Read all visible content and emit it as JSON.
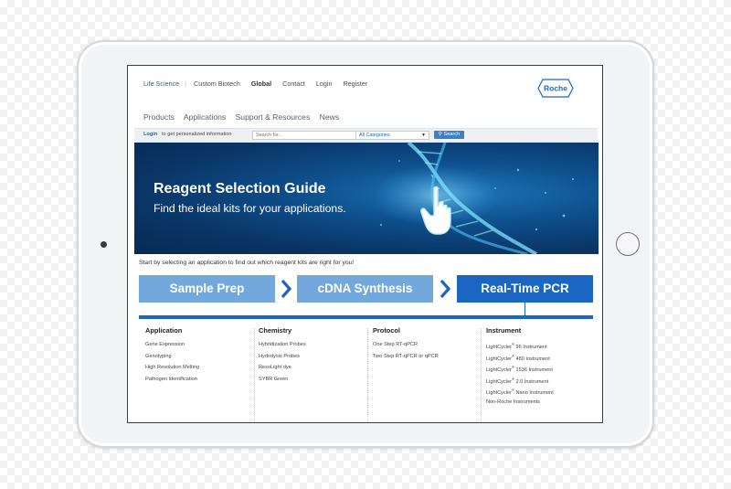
{
  "top_nav": {
    "items": [
      "Life Science",
      "Custom Biotech",
      "Global",
      "Contact",
      "Login",
      "Register"
    ]
  },
  "logo_text": "Roche",
  "main_nav": {
    "items": [
      "Products",
      "Applications",
      "Support & Resources",
      "News"
    ]
  },
  "search_bar": {
    "login_link": "Login",
    "login_text": "to get personalized information",
    "placeholder": "Search for...",
    "category": "All Categories",
    "button_label": "Search"
  },
  "hero": {
    "title": "Reagent Selection Guide",
    "subtitle": "Find the ideal kits for your applications."
  },
  "intro_text": "Start by selecting an application to find out which reagent kits are right for you!",
  "steps": [
    {
      "label": "Sample Prep"
    },
    {
      "label": "cDNA Synthesis"
    },
    {
      "label": "Real-Time PCR"
    }
  ],
  "columns": [
    {
      "heading": "Application",
      "items": [
        "Gene Expression",
        "Genotyping",
        "High Resolution Melting",
        "Pathogen Identification"
      ]
    },
    {
      "heading": "Chemistry",
      "items": [
        "Hybridization Probes",
        "Hydrolysis Probes",
        "ResoLight dye",
        "SYBR Green"
      ]
    },
    {
      "heading": "Protocol",
      "items": [
        "One Step RT-qPCR",
        "Two Step RT-qPCR or qPCR"
      ]
    },
    {
      "heading": "Instrument",
      "items": [
        "96 Instrument",
        "480 Instrument",
        "1536 Instrument",
        "2.0 Instrument",
        "Nano Instrument",
        "Non-Roche Instruments"
      ]
    }
  ],
  "instrument_prefix": "LightCycler",
  "registered_mark": "®",
  "colors": {
    "brand_blue": "#1a66c2",
    "light_step_blue": "#73a8dc",
    "hero_dark": "#0a3566"
  }
}
